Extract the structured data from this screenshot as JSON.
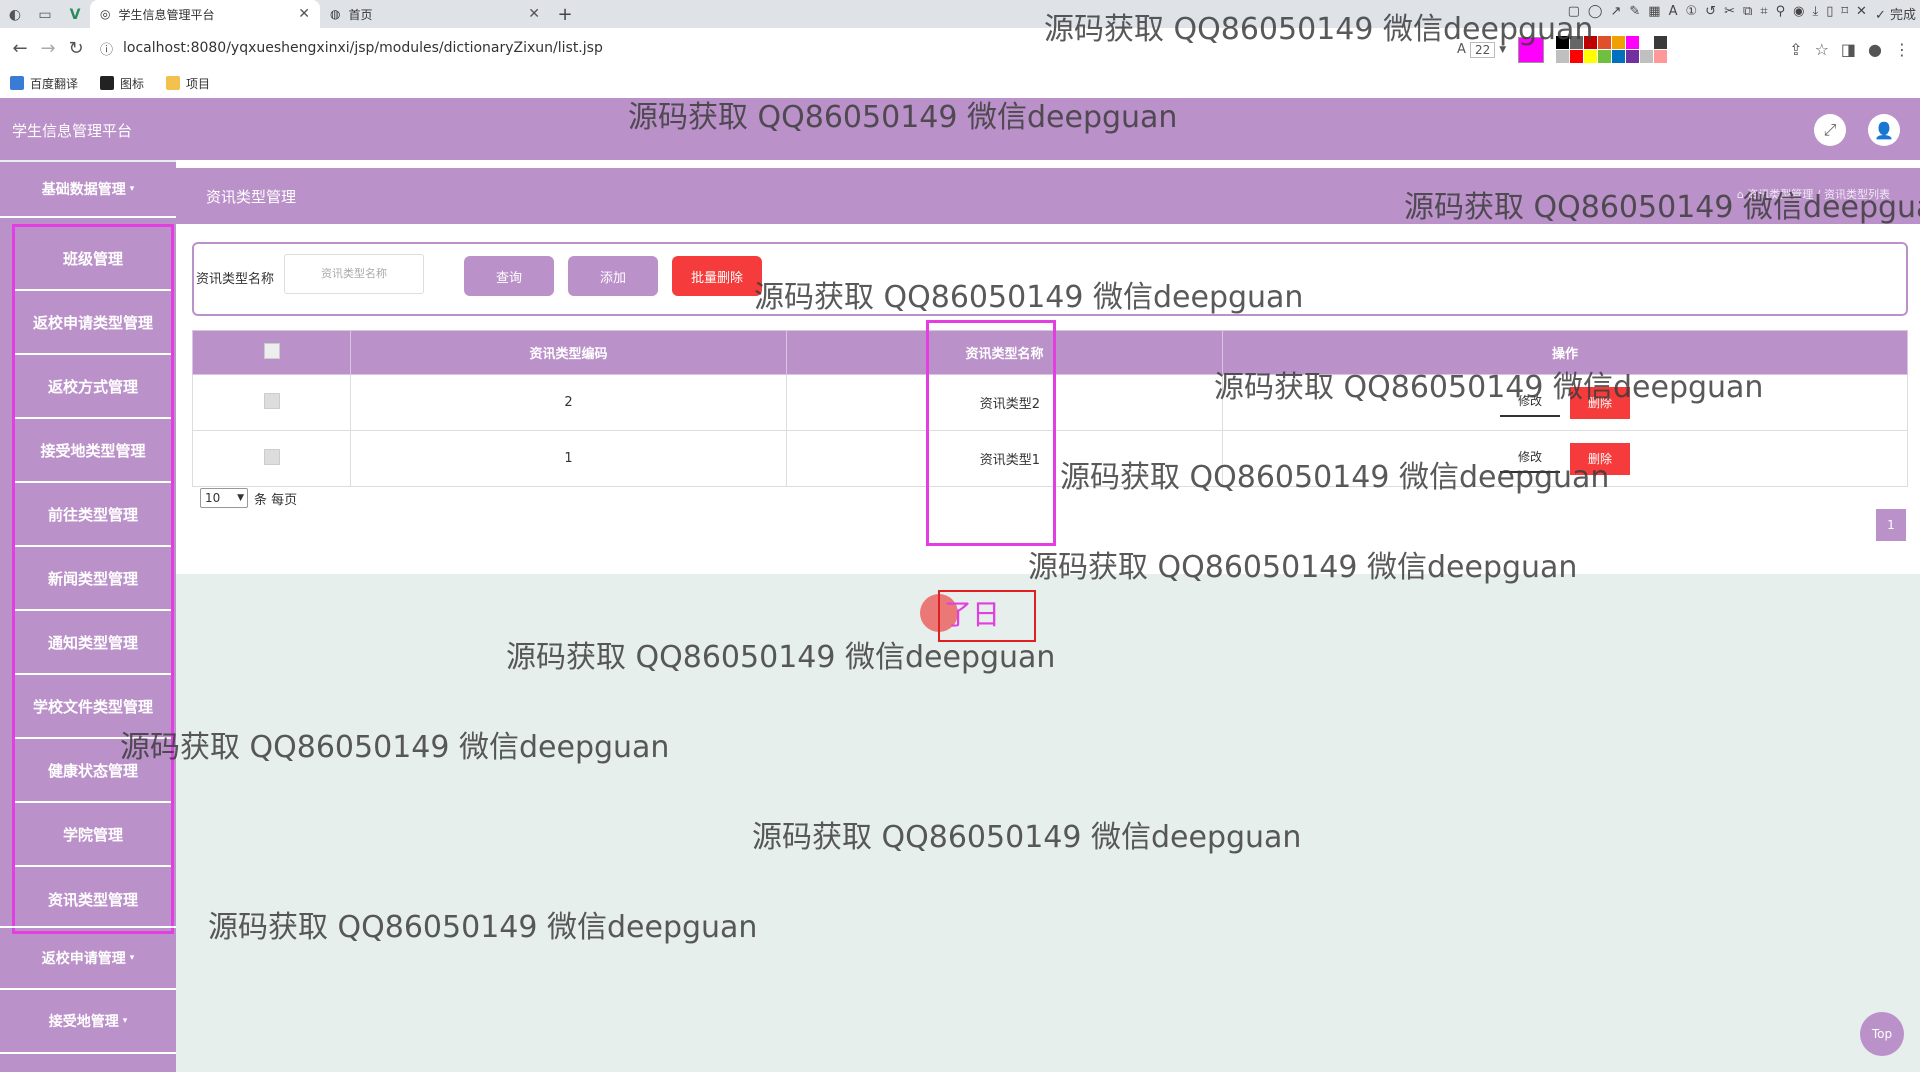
{
  "browser": {
    "tabs": [
      {
        "title": "学生信息管理平台",
        "active": true
      },
      {
        "title": "首页",
        "active": false
      }
    ],
    "url": "localhost:8080/yqxueshengxinxi/jsp/modules/dictionaryZixun/list.jsp",
    "font_size": "22",
    "toolbar_done": "完成",
    "bookmarks": [
      "百度翻译",
      "图标",
      "项目"
    ],
    "palette": [
      "#000000",
      "#666666",
      "#c00000",
      "#e0502a",
      "#f0a000",
      "#ff00ff",
      "#ffffff",
      "#3a3a3a",
      "#bfbfbf",
      "#ff0000",
      "#ffff00",
      "#70c040",
      "#0070c0",
      "#7030a0",
      "#c0c0c0",
      "#ff9999",
      "#ffff99",
      "#33cc33",
      "#3399ff",
      "#00cccc"
    ]
  },
  "app": {
    "title": "学生信息管理平台"
  },
  "sidebar": {
    "group_top": "基础数据管理",
    "items": [
      "班级管理",
      "返校申请类型管理",
      "返校方式管理",
      "接受地类型管理",
      "前往类型管理",
      "新闻类型管理",
      "通知类型管理",
      "学校文件类型管理",
      "健康状态管理",
      "学院管理",
      "资讯类型管理"
    ],
    "group_bottom": [
      "返校申请管理",
      "接受地管理"
    ]
  },
  "page": {
    "title": "资讯类型管理",
    "breadcrumb": "⌂ 资讯类型管理 / 资讯类型列表"
  },
  "search": {
    "label": "资讯类型名称",
    "placeholder": "资讯类型名称",
    "query_btn": "查询",
    "add_btn": "添加",
    "batch_delete_btn": "批量删除"
  },
  "table": {
    "headers": [
      "资讯类型编码",
      "资讯类型名称",
      "操作"
    ],
    "rows": [
      {
        "code": "2",
        "name": "资讯类型2"
      },
      {
        "code": "1",
        "name": "资讯类型1"
      }
    ],
    "edit_label": "修改",
    "delete_label": "删除"
  },
  "pager": {
    "page_size": "10",
    "per_page_text": "条 每页",
    "current_page": "1"
  },
  "overlay": {
    "typed_text": "了日",
    "top_btn": "Top"
  },
  "watermark": "源码获取 QQ86050149 微信deepguan"
}
